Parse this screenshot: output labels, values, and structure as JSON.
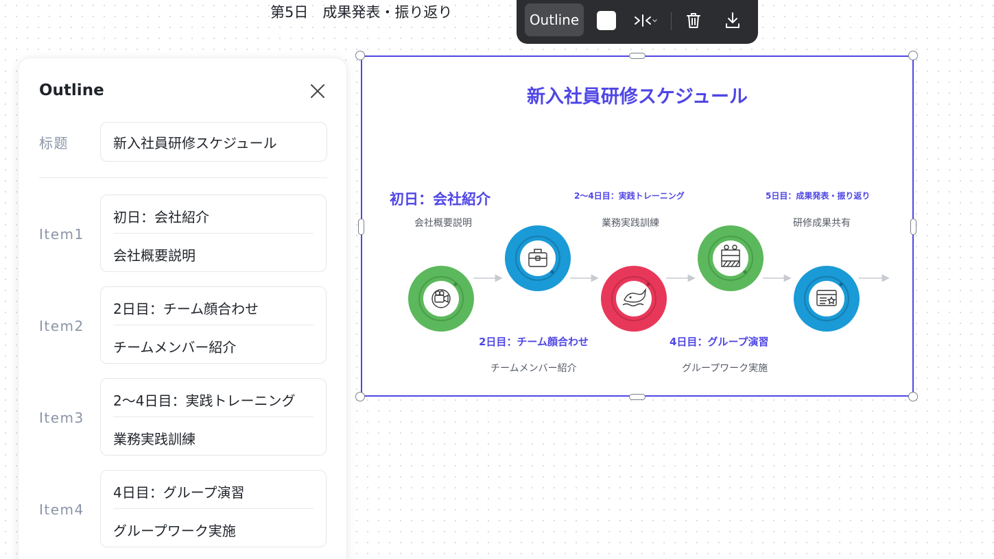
{
  "page": {
    "top_label": "第5日　成果発表・振り返り"
  },
  "toolbar": {
    "outline_label": "Outline",
    "color_icon": "white-square",
    "distribute_icon": "split-horizontal",
    "delete_icon": "trash",
    "download_icon": "download"
  },
  "outline": {
    "title": "Outline",
    "title_field_label": "标题",
    "title_value": "新入社員研修スケジュール",
    "items": [
      {
        "label": "Item1",
        "line1": "初日：会社紹介",
        "line2": "会社概要説明"
      },
      {
        "label": "Item2",
        "line1": "2日目：チーム顔合わせ",
        "line2": "チームメンバー紹介"
      },
      {
        "label": "Item3",
        "line1": "2～4日目：実践トレーニング",
        "line2": "業務実践訓練"
      },
      {
        "label": "Item4",
        "line1": "4日目：グループ演習",
        "line2": "グループワーク実施"
      }
    ]
  },
  "slide": {
    "title": "新入社員研修スケジュール",
    "stages": [
      {
        "title": "初日：会社紹介",
        "sub": "会社概要説明",
        "color": "#5cb85c",
        "icon": "film-camera-icon"
      },
      {
        "title": "2日目：チーム顔合わせ",
        "sub": "チームメンバー紹介",
        "color": "#1a9ad6",
        "icon": "briefcase-icon"
      },
      {
        "title": "2～4日目：実践トレーニング",
        "sub": "業務実践訓練",
        "color": "#e8385a",
        "icon": "whale-icon"
      },
      {
        "title": "4日目：グループ演習",
        "sub": "グループワーク実施",
        "color": "#5cb85c",
        "icon": "work-site-icon"
      },
      {
        "title": "5日目：成果発表・振り返り",
        "sub": "研修成果共有",
        "color": "#1a9ad6",
        "icon": "report-card-icon"
      }
    ]
  },
  "colors": {
    "accent": "#4f46e5",
    "toolbar_bg": "#2c2d30",
    "muted_label": "#8a94a6"
  }
}
